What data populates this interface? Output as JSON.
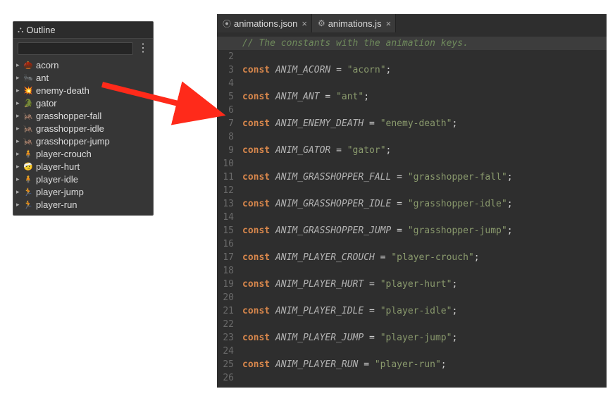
{
  "outline": {
    "title": "Outline",
    "items": [
      {
        "sprite": "🌰",
        "label": "acorn"
      },
      {
        "sprite": "🐜",
        "label": "ant"
      },
      {
        "sprite": "💥",
        "label": "enemy-death"
      },
      {
        "sprite": "🐊",
        "label": "gator"
      },
      {
        "sprite": "🦗",
        "label": "grasshopper-fall"
      },
      {
        "sprite": "🦗",
        "label": "grasshopper-idle"
      },
      {
        "sprite": "🦗",
        "label": "grasshopper-jump"
      },
      {
        "sprite": "🧍",
        "label": "player-crouch"
      },
      {
        "sprite": "🤕",
        "label": "player-hurt"
      },
      {
        "sprite": "🧍",
        "label": "player-idle"
      },
      {
        "sprite": "🏃",
        "label": "player-jump"
      },
      {
        "sprite": "🏃",
        "label": "player-run"
      }
    ]
  },
  "editor": {
    "tabs": [
      {
        "icon": "⦿",
        "label": "animations.json",
        "active": false
      },
      {
        "icon": "⚙",
        "label": "animations.js",
        "active": true
      }
    ],
    "highlight_line": 1,
    "code_lines": [
      {
        "type": "comment",
        "text": "// The constants with the animation keys."
      },
      {
        "type": "blank"
      },
      {
        "type": "const",
        "name": "ANIM_ACORN",
        "value": "acorn"
      },
      {
        "type": "blank"
      },
      {
        "type": "const",
        "name": "ANIM_ANT",
        "value": "ant"
      },
      {
        "type": "blank"
      },
      {
        "type": "const",
        "name": "ANIM_ENEMY_DEATH",
        "value": "enemy-death"
      },
      {
        "type": "blank"
      },
      {
        "type": "const",
        "name": "ANIM_GATOR",
        "value": "gator"
      },
      {
        "type": "blank"
      },
      {
        "type": "const",
        "name": "ANIM_GRASSHOPPER_FALL",
        "value": "grasshopper-fall"
      },
      {
        "type": "blank"
      },
      {
        "type": "const",
        "name": "ANIM_GRASSHOPPER_IDLE",
        "value": "grasshopper-idle"
      },
      {
        "type": "blank"
      },
      {
        "type": "const",
        "name": "ANIM_GRASSHOPPER_JUMP",
        "value": "grasshopper-jump"
      },
      {
        "type": "blank"
      },
      {
        "type": "const",
        "name": "ANIM_PLAYER_CROUCH",
        "value": "player-crouch"
      },
      {
        "type": "blank"
      },
      {
        "type": "const",
        "name": "ANIM_PLAYER_HURT",
        "value": "player-hurt"
      },
      {
        "type": "blank"
      },
      {
        "type": "const",
        "name": "ANIM_PLAYER_IDLE",
        "value": "player-idle"
      },
      {
        "type": "blank"
      },
      {
        "type": "const",
        "name": "ANIM_PLAYER_JUMP",
        "value": "player-jump"
      },
      {
        "type": "blank"
      },
      {
        "type": "const",
        "name": "ANIM_PLAYER_RUN",
        "value": "player-run"
      },
      {
        "type": "blank"
      }
    ]
  },
  "annotation": {
    "color": "#ff2a1a"
  }
}
